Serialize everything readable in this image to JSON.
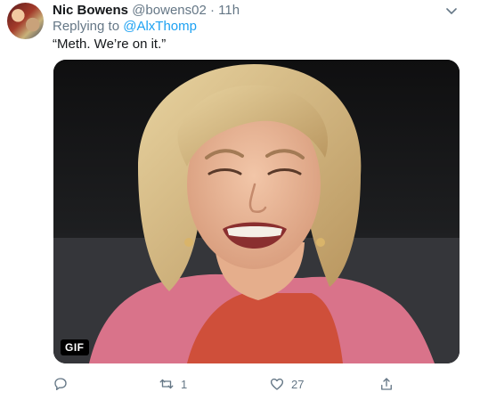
{
  "tweet": {
    "author_name": "Nic Bowens",
    "author_handle": "@bowens02",
    "separator": "·",
    "time": "11h",
    "reply_prefix": "Replying to",
    "reply_to": "@AlxThomp",
    "text": "“Meth. We’re on it.”"
  },
  "media": {
    "badge": "GIF"
  },
  "actions": {
    "reply_icon": "comment-icon",
    "retweet_icon": "retweet-icon",
    "retweet_count": "1",
    "like_icon": "heart-icon",
    "like_count": "27",
    "share_icon": "share-icon"
  },
  "colors": {
    "link": "#1da1f2",
    "muted": "#657786",
    "text": "#14171a"
  }
}
